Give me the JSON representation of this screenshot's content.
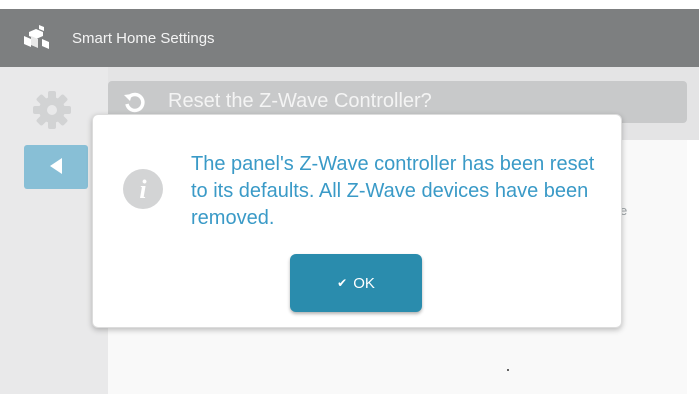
{
  "app": {
    "title": "Smart Home Settings"
  },
  "breadcrumb": {
    "label": "Reset the Z-Wave Controller?"
  },
  "background": {
    "partial_text": "e"
  },
  "dialog": {
    "message": "The panel's Z-Wave controller has been reset to its defaults. All Z-Wave devices have been removed.",
    "ok_check": "✔",
    "ok_label": "OK"
  },
  "icons": {
    "app_logo": "cubes-logo-icon",
    "settings": "gear-icon",
    "back": "back-arrow-icon",
    "reset": "reset-arrow-icon",
    "info": "info-icon"
  },
  "colors": {
    "topbar": "#7d7f80",
    "accent": "#3a9ac7",
    "ok_button": "#2a8cad",
    "back_button": "#88bfd6"
  }
}
